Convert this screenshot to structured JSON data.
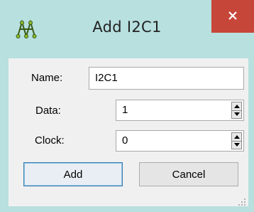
{
  "window": {
    "title": "Add I2C1",
    "app_icon": "seesaw-like-app-icon",
    "close_icon": "close-icon",
    "titlebar_color": "#b7e0df",
    "close_color": "#c7463a"
  },
  "form": {
    "name_label": "Name:",
    "name_value": "I2C1",
    "data_label": "Data:",
    "data_value": "1",
    "clock_label": "Clock:",
    "clock_value": "0"
  },
  "buttons": {
    "add_label": "Add",
    "cancel_label": "Cancel"
  }
}
